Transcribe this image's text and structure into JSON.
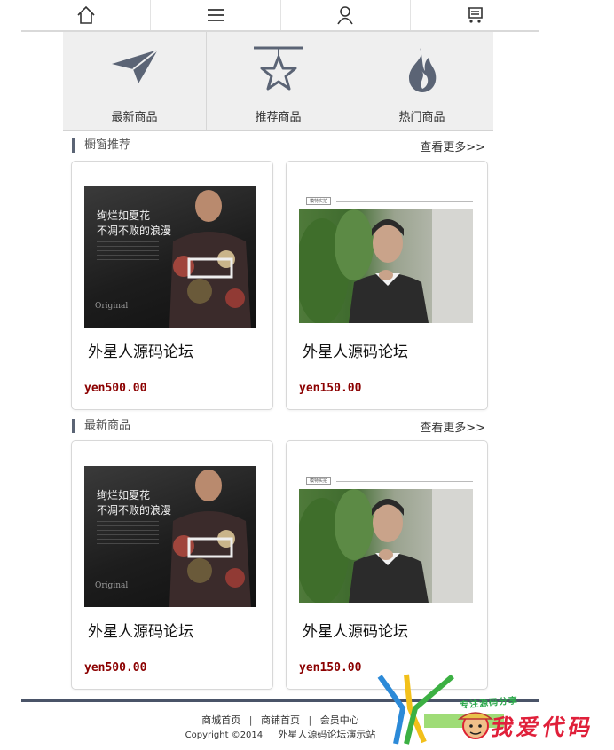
{
  "topnav": {
    "items": [
      {
        "icon": "home-icon"
      },
      {
        "icon": "menu-icon"
      },
      {
        "icon": "user-icon"
      },
      {
        "icon": "cart-icon"
      }
    ]
  },
  "categories": [
    {
      "label": "最新商品",
      "icon": "paper-plane-icon"
    },
    {
      "label": "推荐商品",
      "icon": "star-icon"
    },
    {
      "label": "热门商品",
      "icon": "flame-icon"
    }
  ],
  "sections": [
    {
      "title": "橱窗推荐",
      "more": "查看更多>>",
      "products": [
        {
          "name": "外星人源码论坛",
          "price": "yen500.00"
        },
        {
          "name": "外星人源码论坛",
          "price": "yen150.00"
        }
      ]
    },
    {
      "title": "最新商品",
      "more": "查看更多>>",
      "products": [
        {
          "name": "外星人源码论坛",
          "price": "yen500.00"
        },
        {
          "name": "外星人源码论坛",
          "price": "yen150.00"
        }
      ]
    }
  ],
  "product_image_text": {
    "dark_line1": "绚烂如夏花",
    "dark_line2": "不凋不败的浪漫",
    "dark_brand": "Original",
    "light_tag": "模特实拍"
  },
  "footer": {
    "links": [
      "商城首页",
      "商铺首页",
      "会员中心"
    ],
    "separator": "|",
    "copyright": "Copyright ©2014",
    "site": "外星人源码论坛演示站"
  },
  "watermark": {
    "small": "专注源码分享",
    "big": "我爱代码"
  },
  "colors": {
    "price": "#8b0000",
    "section_bar": "#5b6475",
    "footer_bar": "#4a5468",
    "watermark_red": "#e0203a",
    "watermark_green": "#2aa84a"
  }
}
